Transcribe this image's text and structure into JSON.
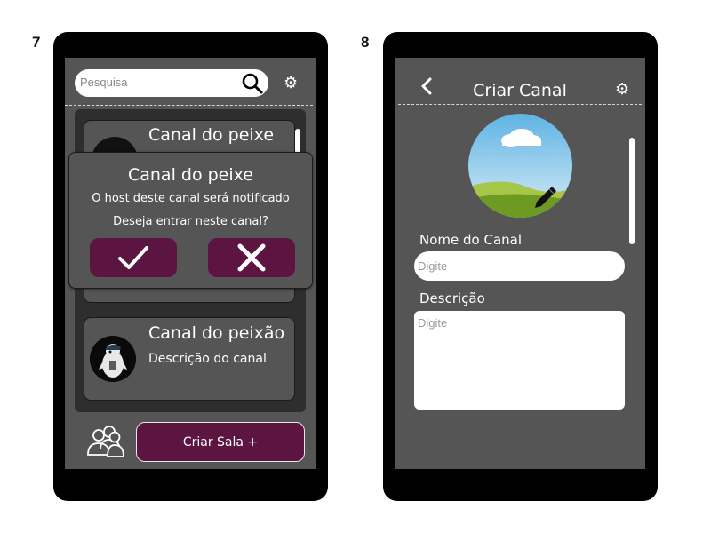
{
  "screens": {
    "screen7": {
      "number": "7",
      "search_placeholder": "Pesquisa",
      "channels": [
        {
          "title": "Canal do peixe"
        },
        {
          "title": "Canal do peixão",
          "description": "Descrição do canal"
        }
      ],
      "modal": {
        "title": "Canal do peixe",
        "line1": "O host deste canal será notificado",
        "line2": "Deseja entrar neste canal?"
      },
      "create_button": "Criar Sala +"
    },
    "screen8": {
      "number": "8",
      "title": "Criar Canal",
      "name_label": "Nome do Canal",
      "name_placeholder": "Digite",
      "desc_label": "Descrição",
      "desc_placeholder": "Digite"
    }
  },
  "colors": {
    "phone_frame": "#000000",
    "screen_bg": "#555555",
    "list_bg": "#2e2e2e",
    "accent": "#5c1440"
  },
  "icons": [
    "search-icon",
    "gear-icon",
    "check-icon",
    "close-icon",
    "people-icon",
    "back-icon",
    "pencil-icon"
  ]
}
